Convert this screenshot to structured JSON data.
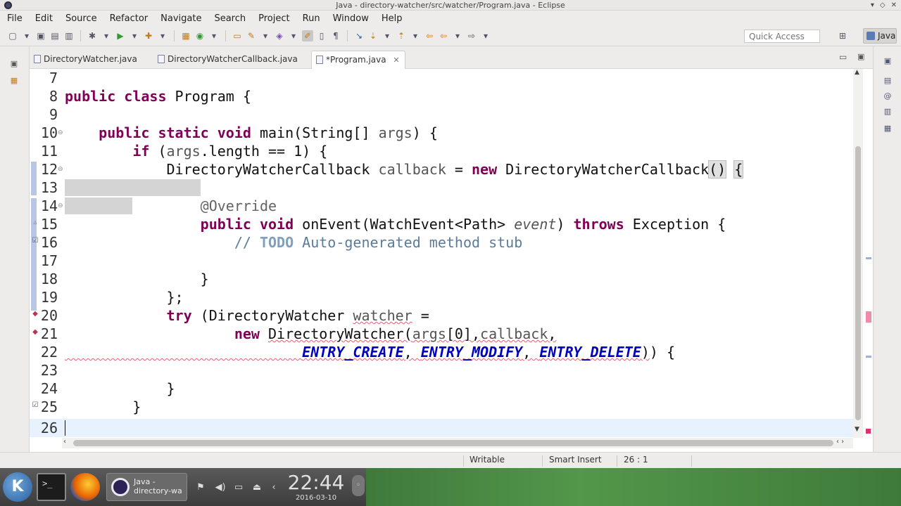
{
  "window": {
    "title": "Java - directory-watcher/src/watcher/Program.java - Eclipse"
  },
  "menu": [
    "File",
    "Edit",
    "Source",
    "Refactor",
    "Navigate",
    "Search",
    "Project",
    "Run",
    "Window",
    "Help"
  ],
  "toolbar": {
    "quick_access_placeholder": "Quick Access",
    "perspective": "Java"
  },
  "tabs": [
    {
      "label": "DirectoryWatcher.java",
      "active": false
    },
    {
      "label": "DirectoryWatcherCallback.java",
      "active": false
    },
    {
      "label": "*Program.java",
      "active": true
    }
  ],
  "editor": {
    "lines": [
      {
        "num": "7"
      },
      {
        "num": "8",
        "text": "public class Program {"
      },
      {
        "num": "9"
      },
      {
        "num": "10",
        "text": "    public static void main(String[] args) {"
      },
      {
        "num": "11",
        "text": "        if (args.length == 1) {"
      },
      {
        "num": "12",
        "text": "            DirectoryWatcherCallback callback = new DirectoryWatcherCallback() {"
      },
      {
        "num": "13"
      },
      {
        "num": "14",
        "text": "                @Override"
      },
      {
        "num": "15",
        "text": "                public void onEvent(WatchEvent<Path> event) throws Exception {"
      },
      {
        "num": "16",
        "text": "                    // TODO Auto-generated method stub"
      },
      {
        "num": "17"
      },
      {
        "num": "18",
        "text": "                }"
      },
      {
        "num": "19",
        "text": "            };"
      },
      {
        "num": "20",
        "text": "            try (DirectoryWatcher watcher ="
      },
      {
        "num": "21",
        "text": "                    new DirectoryWatcher(args[0],callback,"
      },
      {
        "num": "22",
        "text": "                            ENTRY_CREATE, ENTRY_MODIFY, ENTRY_DELETE)) {"
      },
      {
        "num": "23"
      },
      {
        "num": "24",
        "text": "            }"
      },
      {
        "num": "25",
        "text": "        }"
      },
      {
        "num": "26"
      }
    ]
  },
  "status": {
    "writable": "Writable",
    "insert_mode": "Smart Insert",
    "position": "26 : 1"
  },
  "taskbar": {
    "task_label_line1": "Java -",
    "task_label_line2": "directory-wa",
    "clock_time": "22:44",
    "clock_date": "2016-03-10"
  },
  "colors": {
    "keyword": "#7f0055",
    "constant": "#0000c0",
    "comment": "#5a7c9a",
    "current_line": "#e8f2fe",
    "desktop_green": "#53974a"
  }
}
